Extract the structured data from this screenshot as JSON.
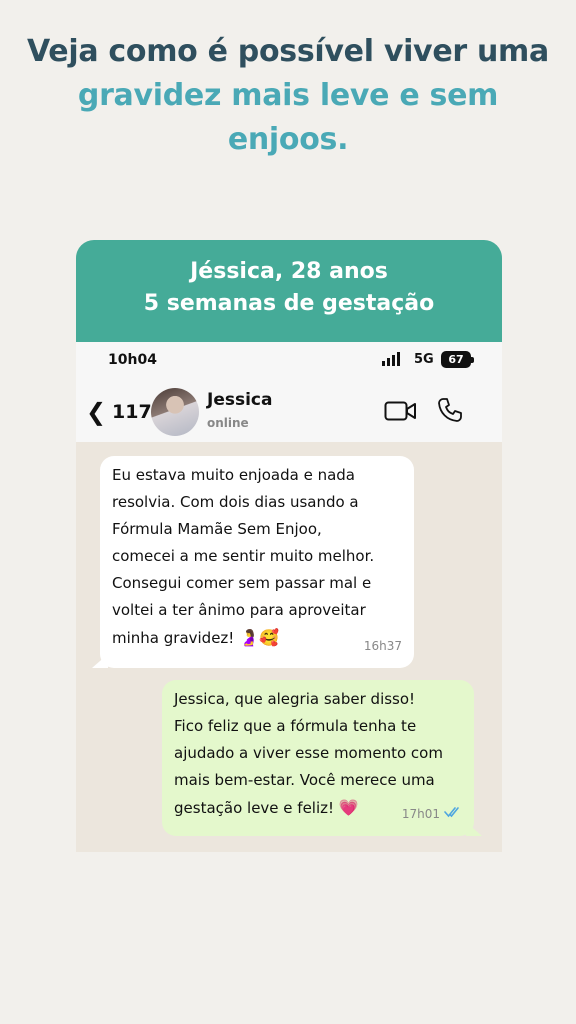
{
  "headline": {
    "line1": "Veja como é possível viver uma",
    "line2": "gravidez mais leve e sem",
    "line3": "enjoos."
  },
  "card": {
    "title_line1": "Jéssica, 28 anos",
    "title_line2": "5 semanas de gestação"
  },
  "status_bar": {
    "time": "10h04",
    "network": "5G",
    "battery": "67"
  },
  "chat_header": {
    "unread_count": "117",
    "contact_name": "Jessica",
    "contact_status": "online"
  },
  "messages": [
    {
      "direction": "incoming",
      "text": "Eu estava muito enjoada e nada\nresolvia. Com dois dias usando a\nFórmula Mamãe Sem Enjoo,\ncomecei a me sentir muito melhor.\nConsegui comer sem passar mal e\nvoltei a ter ânimo para aproveitar\nminha gravidez!",
      "emoji": "🤰🥰",
      "time": "16h37"
    },
    {
      "direction": "outgoing",
      "text": "Jessica, que alegria saber disso!\nFico feliz que a fórmula tenha te\najudado a viver esse momento com\nmais bem-estar. Você merece uma\ngestação leve e feliz!",
      "emoji": "💗",
      "time": "17h01",
      "read_receipt_icon": "double-check-icon"
    }
  ],
  "colors": {
    "background": "#f2f0ec",
    "headline_dark": "#2f4f5e",
    "headline_teal": "#4aa9b6",
    "card_header": "#45ab98",
    "chat_background": "#ece6dd",
    "incoming_bubble": "#ffffff",
    "outgoing_bubble": "#e4f8cc",
    "read_receipt": "#4fa6e0"
  }
}
